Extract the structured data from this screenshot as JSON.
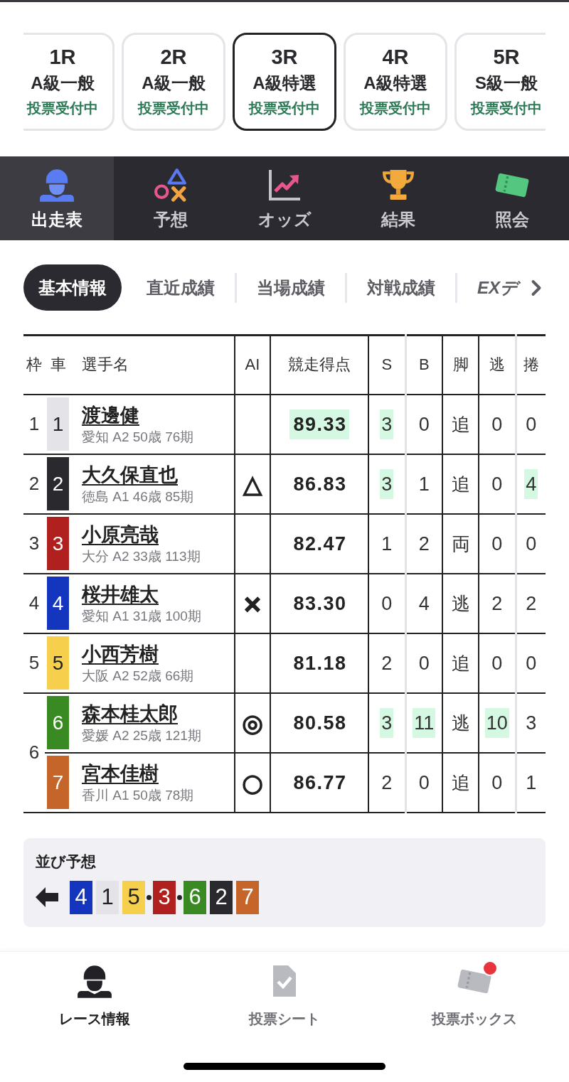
{
  "race_cards": [
    {
      "race": "1R",
      "class": "A級一般",
      "status": "投票受付中",
      "selected": false
    },
    {
      "race": "2R",
      "class": "A級一般",
      "status": "投票受付中",
      "selected": false
    },
    {
      "race": "3R",
      "class": "A級特選",
      "status": "投票受付中",
      "selected": true
    },
    {
      "race": "4R",
      "class": "A級特選",
      "status": "投票受付中",
      "selected": false
    },
    {
      "race": "5R",
      "class": "S級一般",
      "status": "投票受付中",
      "selected": false
    }
  ],
  "nav_tabs": [
    {
      "label": "出走表",
      "selected": true
    },
    {
      "label": "予想",
      "selected": false
    },
    {
      "label": "オッズ",
      "selected": false
    },
    {
      "label": "結果",
      "selected": false
    },
    {
      "label": "照会",
      "selected": false
    }
  ],
  "sub_tabs": [
    {
      "label": "基本情報",
      "selected": true
    },
    {
      "label": "直近成績",
      "selected": false
    },
    {
      "label": "当場成績",
      "selected": false
    },
    {
      "label": "対戦成績",
      "selected": false
    },
    {
      "label": "EXデ",
      "selected": false
    }
  ],
  "table": {
    "columns": [
      "枠",
      "車",
      "選手名",
      "AI",
      "競走得点",
      "S",
      "B",
      "脚",
      "逃",
      "捲"
    ],
    "frames": [
      {
        "frame": "1",
        "racers": [
          {
            "car": "1",
            "color": "#e3e3e8",
            "name": "渡邊健",
            "info": "愛知 A2 50歳 76期",
            "score": {
              "value": "89.33",
              "highlighted": true
            },
            "s": {
              "value": "3",
              "highlighted": true
            },
            "b": {
              "value": "0",
              "highlighted": false
            },
            "leg": "追",
            "nige": {
              "value": "0",
              "highlighted": false
            },
            "makuri": {
              "value": "0",
              "highlighted": false
            }
          }
        ]
      },
      {
        "frame": "2",
        "racers": [
          {
            "car": "2",
            "color": "#2a292e",
            "name": "大久保直也",
            "info": "徳島 A1 46歳 85期",
            "ai": "△",
            "score": {
              "value": "86.83",
              "highlighted": false
            },
            "s": {
              "value": "3",
              "highlighted": true
            },
            "b": {
              "value": "1",
              "highlighted": false
            },
            "leg": "追",
            "nige": {
              "value": "0",
              "highlighted": false
            },
            "makuri": {
              "value": "4",
              "highlighted": true
            }
          }
        ]
      },
      {
        "frame": "3",
        "racers": [
          {
            "car": "3",
            "color": "#b0201f",
            "name": "小原亮哉",
            "info": "大分 A2 33歳 113期",
            "score": {
              "value": "82.47",
              "highlighted": false
            },
            "s": {
              "value": "1",
              "highlighted": false
            },
            "b": {
              "value": "2",
              "highlighted": false
            },
            "leg": "両",
            "nige": {
              "value": "0",
              "highlighted": false
            },
            "makuri": {
              "value": "0",
              "highlighted": false
            }
          }
        ]
      },
      {
        "frame": "4",
        "racers": [
          {
            "car": "4",
            "color": "#1436be",
            "name": "桜井雄太",
            "info": "愛知 A1 31歳 100期",
            "ai": "×",
            "score": {
              "value": "83.30",
              "highlighted": false
            },
            "s": {
              "value": "0",
              "highlighted": false
            },
            "b": {
              "value": "4",
              "highlighted": false
            },
            "leg": "逃",
            "nige": {
              "value": "2",
              "highlighted": false
            },
            "makuri": {
              "value": "2",
              "highlighted": false
            }
          }
        ]
      },
      {
        "frame": "5",
        "racers": [
          {
            "car": "5",
            "color": "#f6d04d",
            "name": "小西芳樹",
            "info": "大阪 A2 52歳 66期",
            "score": {
              "value": "81.18",
              "highlighted": false
            },
            "s": {
              "value": "2",
              "highlighted": false
            },
            "b": {
              "value": "0",
              "highlighted": false
            },
            "leg": "追",
            "nige": {
              "value": "0",
              "highlighted": false
            },
            "makuri": {
              "value": "0",
              "highlighted": false
            }
          }
        ]
      },
      {
        "frame": "6",
        "racers": [
          {
            "car": "6",
            "color": "#3a8a24",
            "name": "森本桂太郎",
            "info": "愛媛 A2 25歳 121期",
            "ai": "◎",
            "score": {
              "value": "80.58",
              "highlighted": false
            },
            "s": {
              "value": "3",
              "highlighted": true
            },
            "b": {
              "value": "11",
              "highlighted": true
            },
            "leg": "逃",
            "nige": {
              "value": "10",
              "highlighted": true
            },
            "makuri": {
              "value": "3",
              "highlighted": false
            }
          },
          {
            "car": "7",
            "color": "#c6652a",
            "name": "宮本佳樹",
            "info": "香川 A1 50歳 78期",
            "ai": "○",
            "score": {
              "value": "86.77",
              "highlighted": false
            },
            "s": {
              "value": "2",
              "highlighted": false
            },
            "b": {
              "value": "0",
              "highlighted": false
            },
            "leg": "追",
            "nige": {
              "value": "0",
              "highlighted": false
            },
            "makuri": {
              "value": "1",
              "highlighted": false
            }
          }
        ]
      }
    ]
  },
  "formation": {
    "title": "並び予想",
    "groups": [
      {
        "cars": [
          {
            "car": "4",
            "color": "#1436be"
          },
          {
            "car": "1",
            "color": "#e3e3e8"
          },
          {
            "car": "5",
            "color": "#f6d04d"
          }
        ]
      },
      {
        "cars": [
          {
            "car": "3",
            "color": "#b0201f"
          }
        ]
      },
      {
        "cars": [
          {
            "car": "6",
            "color": "#3a8a24"
          },
          {
            "car": "2",
            "color": "#2a292e"
          },
          {
            "car": "7",
            "color": "#c6652a"
          }
        ]
      }
    ]
  },
  "bottom_nav": [
    {
      "label": "レース情報",
      "selected": true,
      "notification": false
    },
    {
      "label": "投票シート",
      "selected": false,
      "notification": false
    },
    {
      "label": "投票ボックス",
      "selected": false,
      "notification": true
    }
  ]
}
